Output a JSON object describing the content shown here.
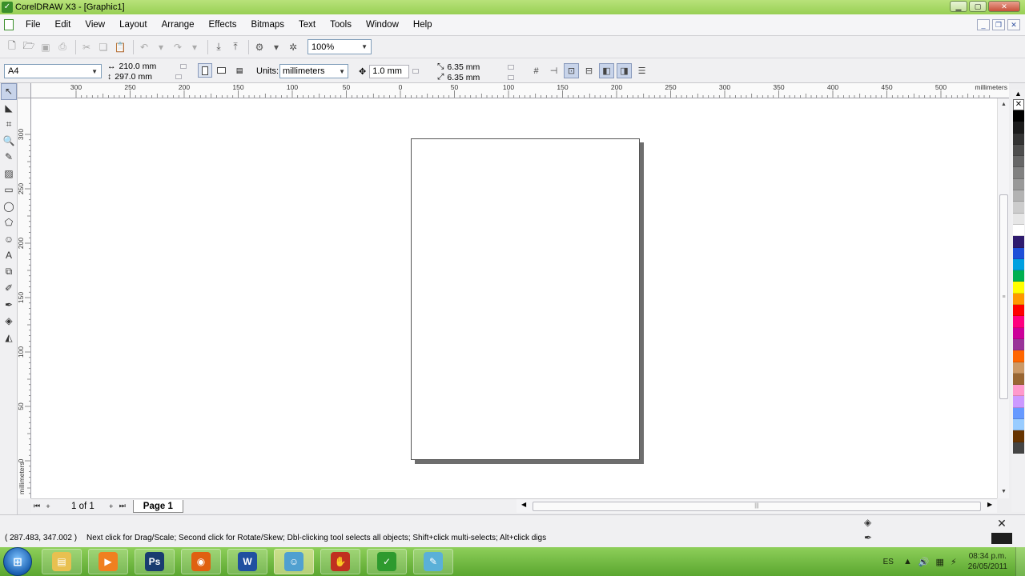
{
  "window": {
    "title": "CorelDRAW X3 - [Graphic1]",
    "minimize": "▁",
    "maximize": "▢",
    "close": "✕"
  },
  "menu": {
    "items": [
      {
        "label": "File",
        "key": "F"
      },
      {
        "label": "Edit",
        "key": "E"
      },
      {
        "label": "View",
        "key": "V"
      },
      {
        "label": "Layout",
        "key": "L"
      },
      {
        "label": "Arrange",
        "key": "A"
      },
      {
        "label": "Effects",
        "key": "c"
      },
      {
        "label": "Bitmaps",
        "key": "B"
      },
      {
        "label": "Text",
        "key": "T"
      },
      {
        "label": "Tools",
        "key": "o"
      },
      {
        "label": "Window",
        "key": "W"
      },
      {
        "label": "Help",
        "key": "H"
      }
    ]
  },
  "standard_toolbar": {
    "zoom_level": "100%"
  },
  "property_bar": {
    "paper_size": "A4",
    "page_width": "210.0 mm",
    "page_height": "297.0 mm",
    "units_label": "Units:",
    "units_value": "millimeters",
    "nudge_value": "1.0 mm",
    "duplicate_x": "6.35 mm",
    "duplicate_y": "6.35 mm"
  },
  "rulers": {
    "units_label": "millimeters",
    "h_ticks": [
      "300",
      "250",
      "200",
      "150",
      "100",
      "50",
      "0",
      "50",
      "100",
      "150",
      "200",
      "250",
      "300",
      "350",
      "400",
      "450",
      "500"
    ],
    "v_ticks": [
      "300",
      "250",
      "200",
      "150",
      "100",
      "50",
      "0"
    ]
  },
  "page_navigator": {
    "page_count": "1 of 1",
    "current_tab": "Page 1"
  },
  "status_bar": {
    "coordinates": "( 287.483, 347.002 )",
    "message": "Next click for Drag/Scale; Second click for Rotate/Skew; Dbl-clicking tool selects all objects; Shift+click multi-selects; Alt+click digs"
  },
  "palette": {
    "colors": [
      "#000000",
      "#1a1a1a",
      "#333333",
      "#4d4d4d",
      "#666666",
      "#808080",
      "#999999",
      "#b3b3b3",
      "#cccccc",
      "#e6e6e6",
      "#ffffff",
      "#2e1a6e",
      "#1e4fd8",
      "#00a0e0",
      "#00b050",
      "#ffff00",
      "#ff9900",
      "#ff0000",
      "#ff007f",
      "#cc0099",
      "#993399",
      "#ff6600",
      "#cc9966",
      "#996633",
      "#ff99cc",
      "#cc99ff",
      "#6699ff",
      "#99ccff",
      "#663300",
      "#444444"
    ]
  },
  "taskbar": {
    "start_label": "⊞",
    "apps": [
      {
        "name": "explorer-icon",
        "glyph": "▤",
        "color": "#e8c050",
        "active": false
      },
      {
        "name": "media-player-icon",
        "glyph": "▶",
        "color": "#f08020",
        "active": false
      },
      {
        "name": "photoshop-icon",
        "glyph": "Ps",
        "color": "#1a3c70",
        "active": false
      },
      {
        "name": "firefox-icon",
        "glyph": "◉",
        "color": "#e06010",
        "active": false
      },
      {
        "name": "word-icon",
        "glyph": "W",
        "color": "#2050a0",
        "active": false
      },
      {
        "name": "messenger-icon",
        "glyph": "☺",
        "color": "#50a0d0",
        "active": true
      },
      {
        "name": "paw-app-icon",
        "glyph": "✋",
        "color": "#c03020",
        "active": false
      },
      {
        "name": "coreldraw-icon",
        "glyph": "✓",
        "color": "#2e9a2e",
        "active": false
      },
      {
        "name": "notepad-icon",
        "glyph": "✎",
        "color": "#5ab0d8",
        "active": false
      }
    ],
    "language": "ES",
    "time": "08:34 p.m.",
    "date": "26/05/2011"
  }
}
